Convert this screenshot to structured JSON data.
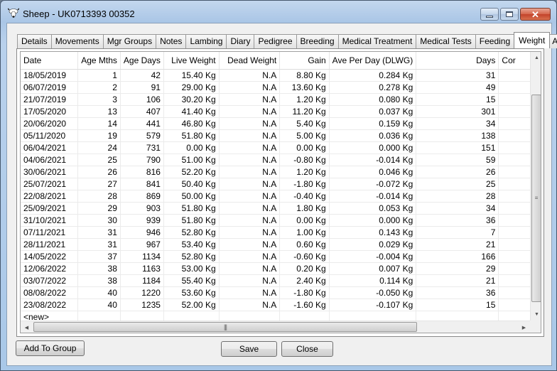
{
  "window": {
    "title": "Sheep - UK0713393 00352",
    "app_icon": "sheep-icon",
    "controls": [
      "minimize-icon",
      "maximize-icon",
      "close-icon"
    ]
  },
  "tabs": [
    {
      "label": "Details",
      "active": false
    },
    {
      "label": "Movements",
      "active": false
    },
    {
      "label": "Mgr Groups",
      "active": false
    },
    {
      "label": "Notes",
      "active": false
    },
    {
      "label": "Lambing",
      "active": false
    },
    {
      "label": "Diary",
      "active": false
    },
    {
      "label": "Pedigree",
      "active": false
    },
    {
      "label": "Breeding",
      "active": false
    },
    {
      "label": "Medical Treatment",
      "active": false
    },
    {
      "label": "Medical Tests",
      "active": false
    },
    {
      "label": "Feeding",
      "active": false
    },
    {
      "label": "Weight",
      "active": true
    },
    {
      "label": "A",
      "active": false
    }
  ],
  "grid": {
    "columns": [
      "Date",
      "Age Mths",
      "Age Days",
      "Live Weight",
      "Dead Weight",
      "Gain",
      "Ave Per Day (DLWG)",
      "Days",
      "Cor"
    ],
    "rows": [
      [
        "18/05/2019",
        "1",
        "42",
        "15.40 Kg",
        "N.A",
        "8.80 Kg",
        "0.284 Kg",
        "31"
      ],
      [
        "06/07/2019",
        "2",
        "91",
        "29.00 Kg",
        "N.A",
        "13.60 Kg",
        "0.278 Kg",
        "49"
      ],
      [
        "21/07/2019",
        "3",
        "106",
        "30.20 Kg",
        "N.A",
        "1.20 Kg",
        "0.080 Kg",
        "15"
      ],
      [
        "17/05/2020",
        "13",
        "407",
        "41.40 Kg",
        "N.A",
        "11.20 Kg",
        "0.037 Kg",
        "301"
      ],
      [
        "20/06/2020",
        "14",
        "441",
        "46.80 Kg",
        "N.A",
        "5.40 Kg",
        "0.159 Kg",
        "34"
      ],
      [
        "05/11/2020",
        "19",
        "579",
        "51.80 Kg",
        "N.A",
        "5.00 Kg",
        "0.036 Kg",
        "138"
      ],
      [
        "06/04/2021",
        "24",
        "731",
        "0.00 Kg",
        "N.A",
        "0.00 Kg",
        "0.000 Kg",
        "151"
      ],
      [
        "04/06/2021",
        "25",
        "790",
        "51.00 Kg",
        "N.A",
        "-0.80 Kg",
        "-0.014 Kg",
        "59"
      ],
      [
        "30/06/2021",
        "26",
        "816",
        "52.20 Kg",
        "N.A",
        "1.20 Kg",
        "0.046 Kg",
        "26"
      ],
      [
        "25/07/2021",
        "27",
        "841",
        "50.40 Kg",
        "N.A",
        "-1.80 Kg",
        "-0.072 Kg",
        "25"
      ],
      [
        "22/08/2021",
        "28",
        "869",
        "50.00 Kg",
        "N.A",
        "-0.40 Kg",
        "-0.014 Kg",
        "28"
      ],
      [
        "25/09/2021",
        "29",
        "903",
        "51.80 Kg",
        "N.A",
        "1.80 Kg",
        "0.053 Kg",
        "34"
      ],
      [
        "31/10/2021",
        "30",
        "939",
        "51.80 Kg",
        "N.A",
        "0.00 Kg",
        "0.000 Kg",
        "36"
      ],
      [
        "07/11/2021",
        "31",
        "946",
        "52.80 Kg",
        "N.A",
        "1.00 Kg",
        "0.143 Kg",
        "7"
      ],
      [
        "28/11/2021",
        "31",
        "967",
        "53.40 Kg",
        "N.A",
        "0.60 Kg",
        "0.029 Kg",
        "21"
      ],
      [
        "14/05/2022",
        "37",
        "1134",
        "52.80 Kg",
        "N.A",
        "-0.60 Kg",
        "-0.004 Kg",
        "166"
      ],
      [
        "12/06/2022",
        "38",
        "1163",
        "53.00 Kg",
        "N.A",
        "0.20 Kg",
        "0.007 Kg",
        "29"
      ],
      [
        "03/07/2022",
        "38",
        "1184",
        "55.40 Kg",
        "N.A",
        "2.40 Kg",
        "0.114 Kg",
        "21"
      ],
      [
        "08/08/2022",
        "40",
        "1220",
        "53.60 Kg",
        "N.A",
        "-1.80 Kg",
        "-0.050 Kg",
        "36"
      ],
      [
        "23/08/2022",
        "40",
        "1235",
        "52.00 Kg",
        "N.A",
        "-1.60 Kg",
        "-0.107 Kg",
        "15"
      ]
    ],
    "new_row_label": "<new>"
  },
  "buttons": {
    "add_to_group": "Add To Group",
    "save": "Save",
    "close": "Close"
  }
}
